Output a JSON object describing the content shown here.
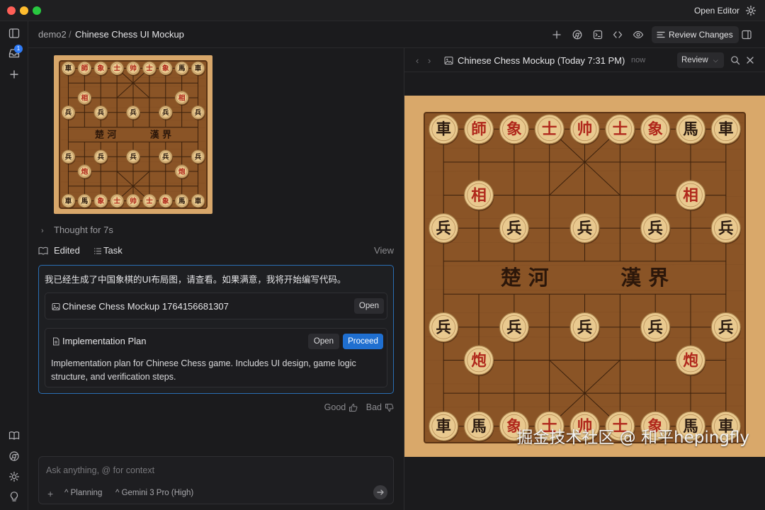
{
  "window": {
    "open_editor_label": "Open Editor",
    "gear_icon": "gear-icon"
  },
  "activity_bar": {
    "items": [
      {
        "icon": "sidebar-toggle-icon"
      },
      {
        "icon": "inbox-icon",
        "badge": "1"
      },
      {
        "icon": "plus-icon"
      },
      {
        "icon": "book-icon"
      },
      {
        "icon": "chrome-icon"
      },
      {
        "icon": "settings-icon"
      },
      {
        "icon": "lightbulb-icon"
      }
    ]
  },
  "breadcrumb": {
    "workspace": "demo2",
    "separator": "/",
    "conversation": "Chinese Chess UI Mockup"
  },
  "toolbar": {
    "review_changes_label": "Review Changes",
    "icons": [
      "plus-icon",
      "browser-icon",
      "terminal-icon",
      "code-icon",
      "eye-icon",
      "list-icon",
      "split-panel-icon"
    ]
  },
  "chat": {
    "thought_label": "Thought for 7s",
    "edited_label": "Edited",
    "task_label": "Task",
    "view_label": "View",
    "message": "我已经生成了中国象棋的UI布局图，请查看。如果满意，我将开始编写代码。",
    "artifact_card": {
      "title": "Chinese Chess Mockup 1764156681307",
      "open_label": "Open"
    },
    "plan_card": {
      "title": "Implementation Plan",
      "open_label": "Open",
      "proceed_label": "Proceed",
      "description": "Implementation plan for Chinese Chess game. Includes UI design, game logic structure, and verification steps."
    },
    "feedback": {
      "good_label": "Good",
      "bad_label": "Bad"
    },
    "input": {
      "placeholder": "Ask anything, @ for context",
      "value": "",
      "mode_label": "Planning",
      "model_label": "Gemini 3 Pro (High)"
    }
  },
  "preview": {
    "title": "Chinese Chess Mockup (Today 7:31 PM)",
    "timestamp": "now",
    "review_label": "Review",
    "board": {
      "river_left": "楚 河",
      "river_right": "漢 界",
      "top_row": [
        "車",
        "師",
        "象",
        "士",
        "帅",
        "士",
        "象",
        "馬",
        "車"
      ],
      "top_cannons": [
        "相",
        "相"
      ],
      "top_soldiers": [
        "兵",
        "兵",
        "兵",
        "兵",
        "兵"
      ],
      "bottom_soldiers": [
        "兵",
        "兵",
        "兵",
        "兵",
        "兵"
      ],
      "bottom_cannons": [
        "炮",
        "炮"
      ],
      "bottom_row": [
        "車",
        "馬",
        "象",
        "士",
        "帅",
        "士",
        "象",
        "馬",
        "車"
      ],
      "colors": {
        "wood": "#8a5426",
        "piece_face": "#e9c98f",
        "red_char": "#b0281c",
        "black_char": "#2a1a10"
      }
    },
    "watermark": "掘金技术社区 @ 和平hepingfly"
  },
  "colors": {
    "accent_blue": "#1f6fd0",
    "focus_border": "#2a6fb4",
    "background": "#1b1b1d"
  }
}
